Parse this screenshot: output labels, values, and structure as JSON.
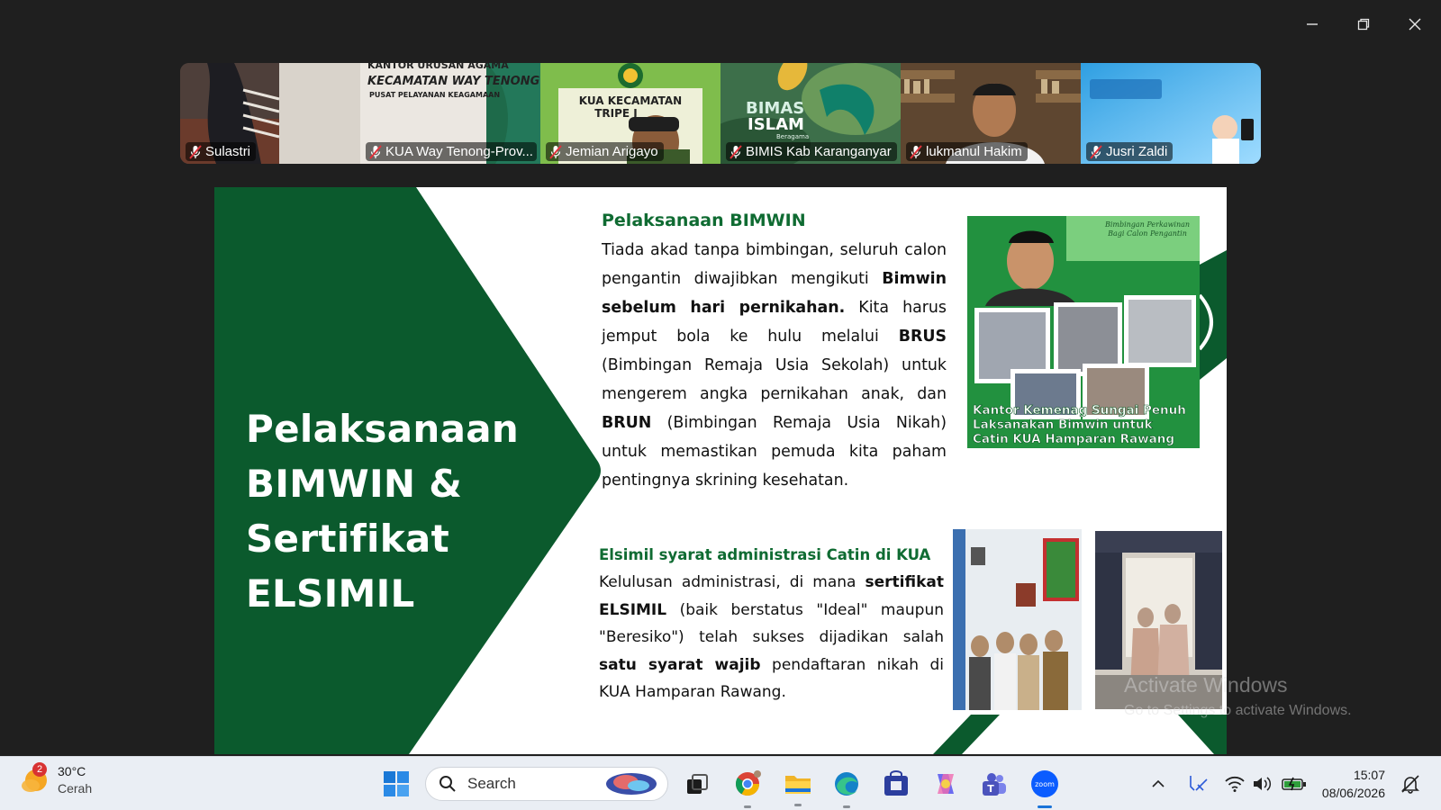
{
  "window": {
    "controls": [
      "minimize",
      "restore",
      "close"
    ]
  },
  "participants": [
    {
      "name": "Sulastri",
      "bg": "#5a4a44",
      "muted": true
    },
    {
      "name": "KUA Way Tenong-Prov...",
      "bg": "#ece8e2",
      "muted": true,
      "sign": {
        "line1": "KANTOR URUSAN AGAMA",
        "line2": "KECAMATAN WAY TENONG",
        "line3": "PUSAT PELAYANAN KEAGAMAAN"
      }
    },
    {
      "name": "Jemian Arigayo",
      "bg": "#79b84a",
      "muted": true,
      "sign": {
        "line1": "KUA KECAMATAN",
        "line2": "TRIPE J"
      }
    },
    {
      "name": "BIMIS Kab Karanganyar",
      "bg": "#2f6a44",
      "muted": true,
      "sign": {
        "line1": "BIMAS",
        "line2": "ISLAM",
        "line3": "Beragama"
      }
    },
    {
      "name": "lukmanul Hakim",
      "bg": "#6a5238",
      "muted": true
    },
    {
      "name": "Jusri Zaldi",
      "bg": "#3aa8e6",
      "muted": true
    }
  ],
  "slide": {
    "title": "Pelaksanaan BIMWIN & Sertifikat ELSIMIL",
    "section1": {
      "heading": "Pelaksanaan BIMWIN",
      "p1": "Tiada akad tanpa bimbingan, seluruh calon pengantin diwajibkan mengikuti ",
      "b1": "Bimwin sebelum hari pernikahan.",
      "p2": " Kita harus jemput bola ke hulu melalui ",
      "b2": "BRUS",
      "p3": " (Bimbingan Remaja Usia Sekolah) untuk mengerem angka pernikahan anak, dan ",
      "b3": "BRUN",
      "p4": " (Bimbingan Remaja Usia Nikah) untuk memastikan pemuda kita paham pentingnya skrining kesehatan."
    },
    "photo1_caption": {
      "line1": "Kantor Kemenag Sungai Penuh",
      "line2": "Laksanakan Bimwin untuk",
      "line3": "Catin KUA Hamparan Rawang"
    },
    "photo1_banner": {
      "line1": "Bimbingan Perkawinan",
      "line2": "Bagi Calon Pengantin"
    },
    "section2": {
      "heading": "Elsimil syarat administrasi Catin di KUA",
      "p1": "Kelulusan administrasi, di mana ",
      "b1": "sertifikat ELSIMIL",
      "p2": " (baik berstatus \"Ideal\" maupun \"Beresiko\") telah sukses dijadikan salah ",
      "b2": "satu syarat wajib",
      "p3": " pendaftaran nikah di KUA Hamparan Rawang."
    },
    "colors": {
      "primary": "#0b5a2d",
      "accent": "#0f6b32"
    }
  },
  "watermark": {
    "title": "Activate Windows",
    "subtitle": "Go to Settings to activate Windows."
  },
  "taskbar": {
    "weather": {
      "temp": "30°C",
      "condition": "Cerah",
      "badge": "2"
    },
    "search_placeholder": "Search",
    "apps": [
      "windows-start-icon",
      "task-view-icon",
      "chrome-icon",
      "file-explorer-icon",
      "edge-icon",
      "store-icon",
      "copilot-icon",
      "teams-icon",
      "zoom-icon"
    ],
    "zoom_label": "zoom",
    "time": "15:07",
    "date": "08/06/2026"
  }
}
